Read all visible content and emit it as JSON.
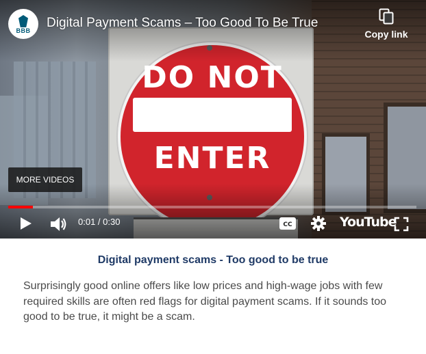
{
  "player": {
    "channel_logo_text": "BBB",
    "title": "Digital Payment Scams – Too Good To Be True",
    "copy_link_label": "Copy link",
    "more_videos_label": "MORE VIDEOS",
    "sign_line1": "DO NOT",
    "sign_line2": "ENTER",
    "time_display": "0:01 / 0:30",
    "progress_fraction": 0.06,
    "youtube_logo_text": "YouTube",
    "icons": [
      "bbb-torch-icon",
      "copy-icon",
      "play-icon",
      "volume-icon",
      "cc-icon",
      "gear-icon",
      "fullscreen-icon"
    ]
  },
  "caption": {
    "title": "Digital payment scams - Too good to be true",
    "body": "Surprisingly good online offers like low prices and high-wage jobs with few required skills are often red flags for digital payment scams. If it sounds too good to be true, it might be a scam."
  },
  "colors": {
    "accent_red": "#ff0000",
    "caption_title": "#1f3a66",
    "caption_text": "#4a4a4a",
    "sign_red": "#d1242c"
  }
}
